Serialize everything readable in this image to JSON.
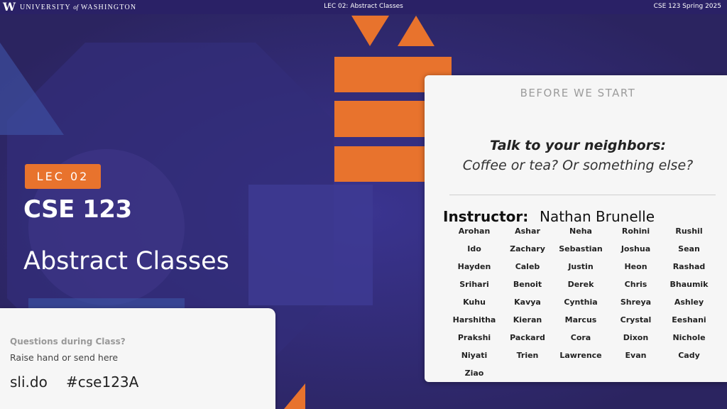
{
  "topbar": {
    "logo_w": "W",
    "logo_text_a": "UNIVERSITY",
    "logo_text_of": "of",
    "logo_text_b": "WASHINGTON",
    "center": "LEC 02: Abstract Classes",
    "right": "CSE 123 Spring 2025"
  },
  "slide": {
    "badge": "LEC 02",
    "course": "CSE 123",
    "title": "Abstract Classes"
  },
  "questions": {
    "label": "Questions during Class?",
    "sub": "Raise hand or send here",
    "site": "sli.do",
    "code": "#cse123A"
  },
  "before_start": {
    "heading": "BEFORE WE START",
    "prompt_bold": "Talk to your neighbors:",
    "prompt": "Coffee or tea? Or something else?",
    "instructor_label": "Instructor:",
    "instructor_name": "Nathan Brunelle",
    "tas": [
      "Arohan",
      "Ashar",
      "Neha",
      "Rohini",
      "Rushil",
      "Ido",
      "Zachary",
      "Sebastian",
      "Joshua",
      "Sean",
      "Hayden",
      "Caleb",
      "Justin",
      "Heon",
      "Rashad",
      "Srihari",
      "Benoit",
      "Derek",
      "Chris",
      "Bhaumik",
      "Kuhu",
      "Kavya",
      "Cynthia",
      "Shreya",
      "Ashley",
      "Harshitha",
      "Kieran",
      "Marcus",
      "Crystal",
      "Eeshani",
      "Prakshi",
      "Packard",
      "Cora",
      "Dixon",
      "Nichole",
      "Niyati",
      "Trien",
      "Lawrence",
      "Evan",
      "Cady",
      "Ziao"
    ]
  },
  "colors": {
    "background": "#2b2460",
    "accent": "#e8732d",
    "card": "#f6f6f6"
  }
}
